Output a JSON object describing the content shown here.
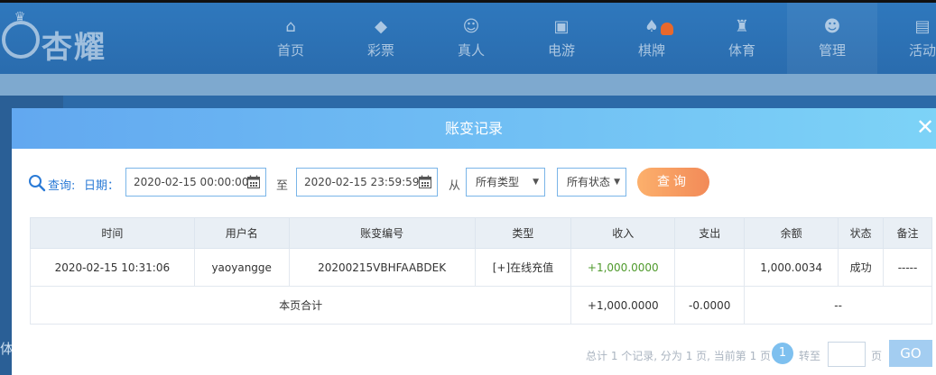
{
  "brand": {
    "name": "杏耀"
  },
  "nav": [
    {
      "label": "首页",
      "icon": "home-icon"
    },
    {
      "label": "彩票",
      "icon": "lottery-icon"
    },
    {
      "label": "真人",
      "icon": "live-dealer-icon"
    },
    {
      "label": "电游",
      "icon": "slot-machine-icon"
    },
    {
      "label": "棋牌",
      "icon": "cards-icon"
    },
    {
      "label": "体育",
      "icon": "trophy-icon"
    },
    {
      "label": "管理",
      "icon": "users-icon"
    },
    {
      "label": "活动",
      "icon": "gift-icon"
    }
  ],
  "sidebar": {
    "partial_label": "体"
  },
  "modal": {
    "title": "账变记录",
    "close_symbol": "✕"
  },
  "filters": {
    "query_label": "查询:",
    "date_label": "日期：",
    "start_date": "2020-02-15 00:00:00",
    "to_label": "至",
    "end_date": "2020-02-15 23:59:59",
    "from_label": "从",
    "type_select": "所有类型",
    "status_select": "所有状态",
    "query_button": "查询"
  },
  "table": {
    "headers": [
      "时间",
      "用户名",
      "账变编号",
      "类型",
      "收入",
      "支出",
      "余额",
      "状态",
      "备注"
    ],
    "rows": [
      {
        "time": "2020-02-15 10:31:06",
        "username": "yaoyangge",
        "serial": "20200215VBHFAABDEK",
        "type": "[+]在线充值",
        "income": "+1,000.0000",
        "expense": "",
        "balance": "1,000.0034",
        "status": "成功",
        "remark": "-----"
      }
    ],
    "summary": {
      "label": "本页合计",
      "income": "+1,000.0000",
      "expense": "-0.0000",
      "rest": "--"
    }
  },
  "pager": {
    "summary_text": "总计 1 个记录, 分为 1 页, 当前第 1 页",
    "current_page": "1",
    "goto_label": "转至",
    "page_unit": "页",
    "go_button": "GO"
  },
  "colors": {
    "accent": "#2a7ad6",
    "income_green": "#4f9a2c",
    "query_button": "#f28a58",
    "modal_header_start": "#62a8f0",
    "modal_header_end": "#7dd3f7"
  }
}
